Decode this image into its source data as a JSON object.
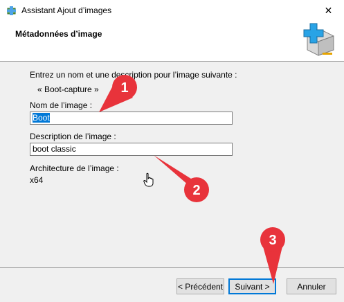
{
  "window": {
    "title": "Assistant Ajout d’images",
    "close_glyph": "✕"
  },
  "header": {
    "title": "Métadonnées d’image"
  },
  "form": {
    "intro": "Entrez un nom et une description pour l’image suivante :",
    "image_ref": "« Boot-capture »",
    "name_label": "Nom de l’image :",
    "name_value": "Boot",
    "desc_label": "Description de l’image :",
    "desc_value": "boot classic",
    "arch_label": "Architecture de l’image :",
    "arch_value": "x64"
  },
  "buttons": {
    "prev": "< Précédent",
    "next": "Suivant >",
    "cancel": "Annuler"
  },
  "callouts": [
    "1",
    "2",
    "3"
  ],
  "colors": {
    "accent": "#0078d7",
    "callout": "#e8333b"
  },
  "icons": {
    "app": "image-add-icon",
    "header": "image-add-large-icon",
    "cursor": "hand-cursor-icon"
  }
}
